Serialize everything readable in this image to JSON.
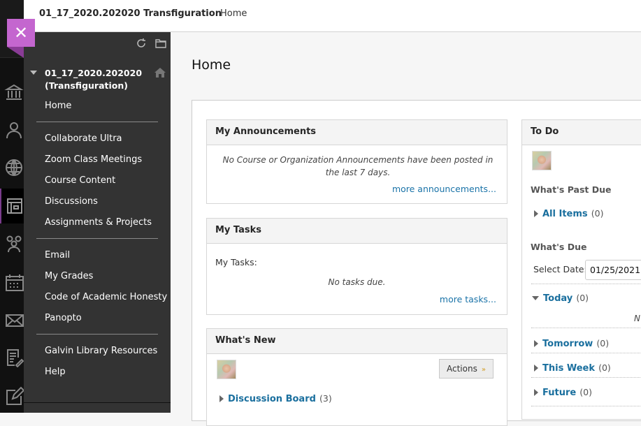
{
  "topbar": {
    "course_title": "01_17_2020.202020 Transfiguration",
    "breadcrumb": "Home"
  },
  "close_label": "✕",
  "rail_icons": [
    "institution-icon",
    "profile-icon",
    "globe-icon",
    "courses-icon",
    "groups-icon",
    "calendar-icon",
    "messages-icon",
    "grades-icon",
    "edit-icon"
  ],
  "menu": {
    "course_title": "01_17_2020.202020 (Transfiguration)",
    "groups": [
      [
        "Home"
      ],
      [
        "Collaborate Ultra",
        "Zoom Class Meetings",
        "Course Content",
        "Discussions",
        "Assignments & Projects"
      ],
      [
        "Email",
        "My Grades",
        "Code of Academic Honesty",
        "Panopto"
      ],
      [
        "Galvin Library Resources",
        "Help"
      ]
    ]
  },
  "page_title": "Home",
  "announcements": {
    "title": "My Announcements",
    "message": "No Course or Organization Announcements have been posted in the last 7 days.",
    "more_link": "more announcements..."
  },
  "tasks": {
    "title": "My Tasks",
    "label": "My Tasks:",
    "message": "No tasks due.",
    "more_link": "more tasks..."
  },
  "whats_new": {
    "title": "What's New",
    "actions_label": "Actions",
    "items": [
      {
        "label": "Discussion Board",
        "count": "(3)"
      }
    ]
  },
  "todo": {
    "title": "To Do",
    "past_due_heading": "What's Past Due",
    "past_due_items": [
      {
        "label": "All Items",
        "count": "(0)"
      }
    ],
    "due_heading": "What's Due",
    "select_date_label": "Select Date:",
    "select_date_value": "01/25/2021",
    "due_groups": [
      {
        "label": "Today",
        "count": "(0)",
        "expanded": true
      },
      {
        "label": "Tomorrow",
        "count": "(0)"
      },
      {
        "label": "This Week",
        "count": "(0)"
      },
      {
        "label": "Future",
        "count": "(0)"
      }
    ],
    "today_empty_text": "N"
  }
}
